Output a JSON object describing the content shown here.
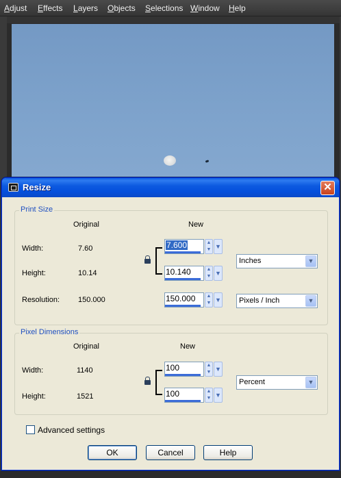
{
  "menu": [
    "Adjust",
    "Effects",
    "Layers",
    "Objects",
    "Selections",
    "Window",
    "Help"
  ],
  "menu_mnemonics": [
    "A",
    "E",
    "L",
    "O",
    "S",
    "W",
    "H"
  ],
  "dialog": {
    "title": "Resize",
    "close_glyph": "✕"
  },
  "print_size": {
    "group_label": "Print Size",
    "col_original": "Original",
    "col_new": "New",
    "width_label": "Width:",
    "width_original": "7.60",
    "width_new": "7.600",
    "height_label": "Height:",
    "height_original": "10.14",
    "height_new": "10.140",
    "resolution_label": "Resolution:",
    "resolution_original": "150.000",
    "resolution_new": "150.000",
    "units": "Inches",
    "resolution_units": "Pixels / Inch"
  },
  "pixel_dimensions": {
    "group_label": "Pixel Dimensions",
    "col_original": "Original",
    "col_new": "New",
    "width_label": "Width:",
    "width_original": "1140",
    "width_new": "100",
    "height_label": "Height:",
    "height_original": "1521",
    "height_new": "100",
    "units": "Percent"
  },
  "advanced_settings": {
    "label": "Advanced settings",
    "checked": false
  },
  "buttons": {
    "ok": "OK",
    "cancel": "Cancel",
    "help": "Help"
  },
  "icons": {
    "spin_arrows": "◆",
    "dropdown": "▼"
  },
  "colors": {
    "titlebar": "#0a5be1",
    "dialog_bg": "#ece9d8",
    "group_label": "#1f4fc0",
    "sky": "#7da2cb"
  }
}
